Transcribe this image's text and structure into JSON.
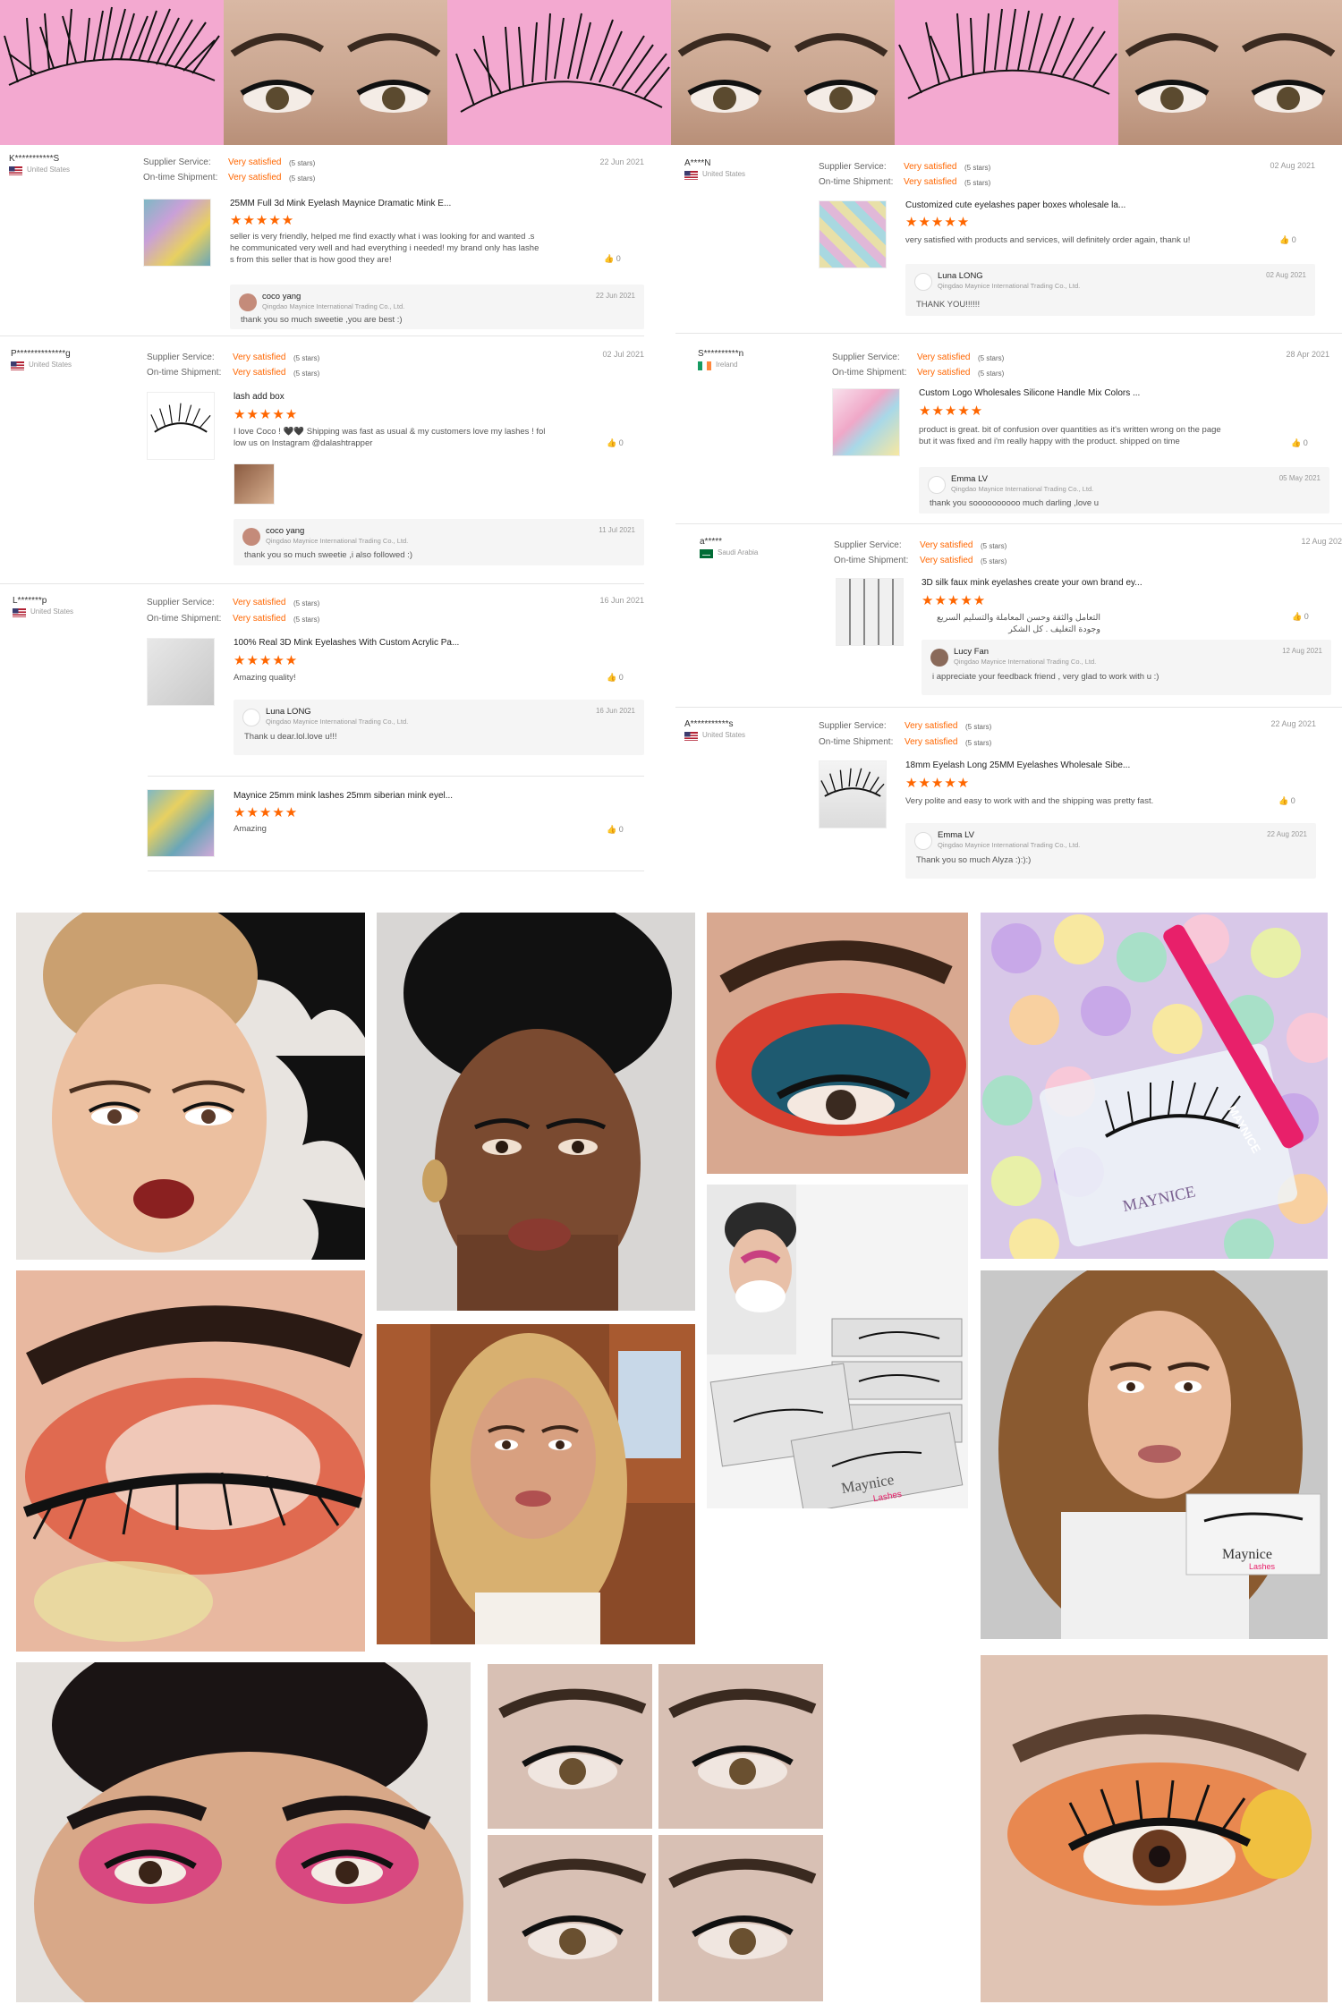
{
  "reviews": [
    {
      "user": "K***********S",
      "country": "United States",
      "supplier_label": "Supplier Service:",
      "shipment_label": "On-time Shipment:",
      "supplier_value": "Very satisfied",
      "supplier_stars": "(5 stars)",
      "shipment_value": "Very satisfied",
      "shipment_stars": "(5 stars)",
      "date": "22 Jun 2021",
      "title": "25MM Full 3d Mink Eyelash Maynice Dramatic Mink E...",
      "stars": "★★★★★",
      "text": [
        "seller is very friendly, helped me find exactly what i was looking for and wanted .s",
        "he communicated very well and had everything i needed! my brand only has lashe",
        "s from this seller that is how good they are!"
      ],
      "likes": "0",
      "reply": {
        "name": "coco yang",
        "company": "Qingdao Maynice International Trading Co., Ltd.",
        "date": "22 Jun 2021",
        "text": "thank you so much sweetie ,you are best :)"
      }
    },
    {
      "user": "A****N",
      "country": "United States",
      "supplier_label": "Supplier Service:",
      "shipment_label": "On-time Shipment:",
      "supplier_value": "Very satisfied",
      "supplier_stars": "(5 stars)",
      "shipment_value": "Very satisfied",
      "shipment_stars": "(5 stars)",
      "date": "02 Aug 2021",
      "title": "Customized cute eyelashes paper boxes wholesale la...",
      "stars": "★★★★★",
      "text": [
        "very satisfied with products and services, will definitely order again, thank u!"
      ],
      "likes": "0",
      "reply": {
        "name": "Luna LONG",
        "company": "Qingdao Maynice International Trading Co., Ltd.",
        "date": "02 Aug 2021",
        "text": "THANK YOU!!!!!!"
      }
    },
    {
      "user": "P**************g",
      "country": "United States",
      "supplier_label": "Supplier Service:",
      "shipment_label": "On-time Shipment:",
      "supplier_value": "Very satisfied",
      "supplier_stars": "(5 stars)",
      "shipment_value": "Very satisfied",
      "shipment_stars": "(5 stars)",
      "date": "02 Jul 2021",
      "title": "lash add box",
      "stars": "★★★★★",
      "text": [
        "I love Coco ! 🖤🖤 Shipping was fast as usual & my customers love my lashes ! fol",
        "low us on Instagram @dalashtrapper"
      ],
      "likes": "0",
      "reply": {
        "name": "coco yang",
        "company": "Qingdao Maynice International Trading Co., Ltd.",
        "date": "11 Jul 2021",
        "text": "thank you so much sweetie ,i also followed :)"
      }
    },
    {
      "user": "S**********n",
      "country": "Ireland",
      "supplier_label": "Supplier Service:",
      "shipment_label": "On-time Shipment:",
      "supplier_value": "Very satisfied",
      "supplier_stars": "(5 stars)",
      "shipment_value": "Very satisfied",
      "shipment_stars": "(5 stars)",
      "date": "28 Apr 2021",
      "title": "Custom Logo Wholesales Silicone Handle Mix Colors ...",
      "stars": "★★★★★",
      "text": [
        "product is great. bit of confusion over quantities as it's written wrong on the page",
        "but it was fixed and i'm really happy with the product. shipped on time"
      ],
      "likes": "0",
      "reply": {
        "name": "Emma LV",
        "company": "Qingdao Maynice International Trading Co., Ltd.",
        "date": "05 May 2021",
        "text": "thank you soooooooooo much darling ,love u"
      }
    },
    {
      "user": "a*****",
      "country": "Saudi Arabia",
      "supplier_label": "Supplier Service:",
      "shipment_label": "On-time Shipment:",
      "supplier_value": "Very satisfied",
      "supplier_stars": "(5 stars)",
      "shipment_value": "Very satisfied",
      "shipment_stars": "(5 stars)",
      "date": "12 Aug 202",
      "title": "3D silk faux mink eyelashes create your own brand ey...",
      "stars": "★★★★★",
      "text": [
        "التعامل والثقة وحسن المعاملة والتسليم السريع وجودة التغليف . كل الشكر"
      ],
      "likes": "0",
      "reply": {
        "name": "Lucy Fan",
        "company": "Qingdao Maynice International Trading Co., Ltd.",
        "date": "12 Aug 2021",
        "text": "i appreciate your feedback friend , very glad to work with u :)"
      }
    },
    {
      "user": "L*******p",
      "country": "United States",
      "supplier_label": "Supplier Service:",
      "shipment_label": "On-time Shipment:",
      "supplier_value": "Very satisfied",
      "supplier_stars": "(5 stars)",
      "shipment_value": "Very satisfied",
      "shipment_stars": "(5 stars)",
      "date": "16 Jun 2021",
      "title": "100% Real 3D Mink Eyelashes With Custom Acrylic Pa...",
      "stars": "★★★★★",
      "text": [
        "Amazing quality!"
      ],
      "likes": "0",
      "reply": {
        "name": "Luna LONG",
        "company": "Qingdao Maynice International Trading Co., Ltd.",
        "date": "16 Jun 2021",
        "text": "Thank u dear.lol.love u!!!"
      }
    },
    {
      "user": "A***********s",
      "country": "United States",
      "supplier_label": "Supplier Service:",
      "shipment_label": "On-time Shipment:",
      "supplier_value": "Very satisfied",
      "supplier_stars": "(5 stars)",
      "shipment_value": "Very satisfied",
      "shipment_stars": "(5 stars)",
      "date": "22 Aug 2021",
      "title": "18mm Eyelash Long 25MM Eyelashes Wholesale Sibe...",
      "stars": "★★★★★",
      "text": [
        "Very polite and easy to work with and the shipping was pretty fast."
      ],
      "likes": "0",
      "reply": {
        "name": "Emma LV",
        "company": "Qingdao Maynice International Trading Co., Ltd.",
        "date": "22 Aug 2021",
        "text": "Thank you so much Alyza :):):)"
      }
    },
    {
      "title": "Maynice 25mm mink lashes 25mm siberian mink eyel...",
      "stars": "★★★★★",
      "text": [
        "Amazing"
      ],
      "likes": "0"
    }
  ],
  "brand": {
    "box_logo": "Maynice",
    "box_sub": "Lashes",
    "tweezer": "MAYNICE"
  },
  "colors": {
    "accent": "#ff6600",
    "pink": "#f3a9d0",
    "reply_bg": "#f5f5f5"
  }
}
